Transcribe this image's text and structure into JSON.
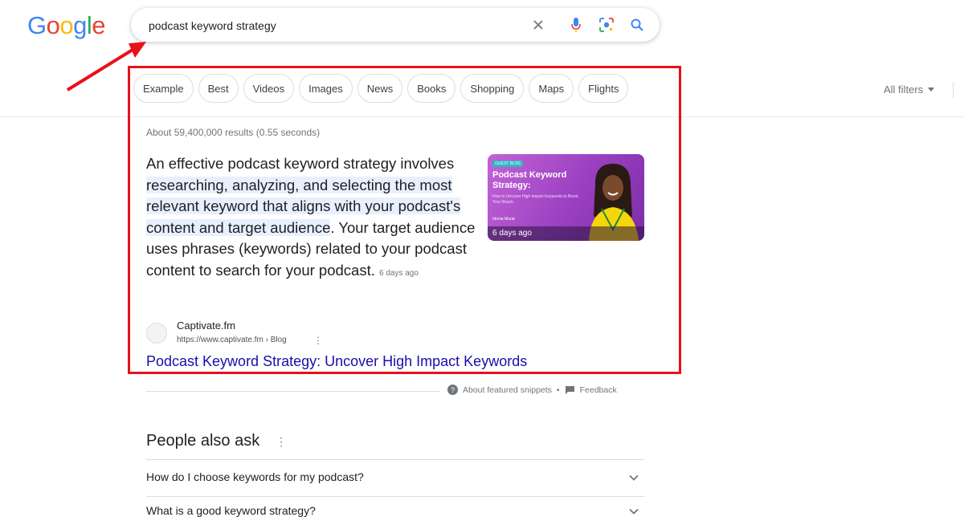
{
  "logo": {
    "letters": [
      "G",
      "o",
      "o",
      "g",
      "l",
      "e"
    ],
    "colors": [
      "#4285F4",
      "#EA4335",
      "#FBBC05",
      "#4285F4",
      "#34A853",
      "#EA4335"
    ]
  },
  "search": {
    "query": "podcast keyword strategy",
    "icons": [
      "close-icon",
      "microphone-icon",
      "lens-icon",
      "search-icon"
    ]
  },
  "chips": [
    "Example",
    "Best",
    "Videos",
    "Images",
    "News",
    "Books",
    "Shopping",
    "Maps",
    "Flights"
  ],
  "filters": {
    "all_filters_label": "All filters"
  },
  "results": {
    "stats": "About 59,400,000 results (0.55 seconds)"
  },
  "snippet": {
    "part1": "An effective podcast keyword strategy involves ",
    "highlight": "researching, analyzing, and selecting the most relevant keyword that aligns with your podcast's content and target audience",
    "part2": ". Your target audience uses phrases (keywords) related to your podcast content to search for your podcast.",
    "date": "6 days ago",
    "thumbnail": {
      "tag": "GUEST BLOG",
      "title": "Podcast Keyword Strategy:",
      "subtitle": "How to Uncover High Impact Keywords to Boost Your Reach",
      "author": "Idonia Murat",
      "date": "6 days ago"
    },
    "source_name": "Captivate.fm",
    "source_url": "https://www.captivate.fm › Blog",
    "link_title": "Podcast Keyword Strategy: Uncover High Impact Keywords"
  },
  "feedback": {
    "about": "About featured snippets",
    "separator": "•",
    "feedback": "Feedback"
  },
  "paa": {
    "title": "People also ask",
    "questions": [
      "How do I choose keywords for my podcast?",
      "What is a good keyword strategy?"
    ]
  },
  "colors": {
    "annotation_red": "#e8101a",
    "link_blue": "#1a0dab",
    "highlight": "#e8f0fe"
  }
}
